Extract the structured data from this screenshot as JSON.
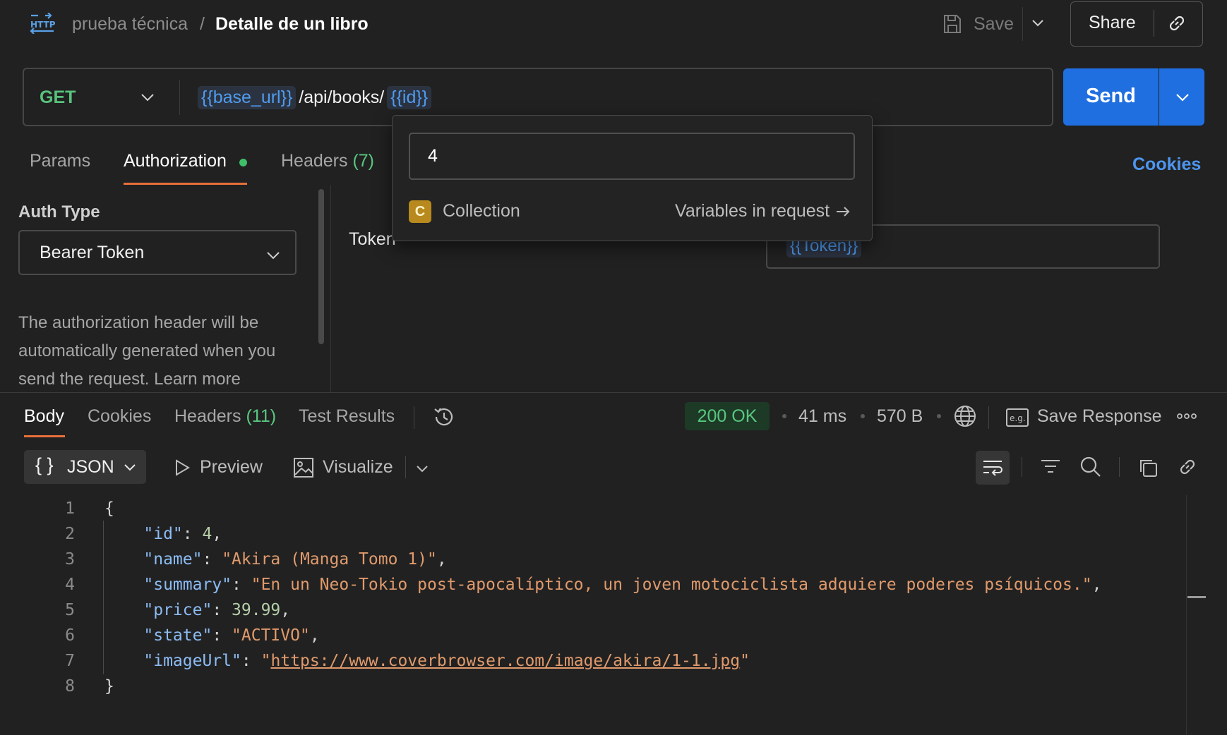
{
  "header": {
    "collection": "prueba técnica",
    "separator": "/",
    "title": "Detalle de un libro",
    "save_label": "Save",
    "share_label": "Share"
  },
  "request": {
    "method": "GET",
    "url_parts": {
      "base": "{{base_url}}",
      "path": "/api/books/",
      "id_var": "{{id}}"
    },
    "send_label": "Send"
  },
  "req_tabs": {
    "params": "Params",
    "authorization": "Authorization",
    "headers": "Headers",
    "headers_count": "(7)",
    "cookies": "Cookies"
  },
  "auth": {
    "type_label": "Auth Type",
    "type_value": "Bearer Token",
    "description": "The authorization header will be automatically generated when you send the request. Learn more",
    "token_label": "Token",
    "token_value": "{{Token}}"
  },
  "popover": {
    "value": "4",
    "scope_badge": "C",
    "scope_name": "Collection",
    "link_label": "Variables in request"
  },
  "response": {
    "tabs": {
      "body": "Body",
      "cookies": "Cookies",
      "headers": "Headers",
      "headers_count": "(11)",
      "tests": "Test Results"
    },
    "status": "200 OK",
    "time": "41 ms",
    "size": "570 B",
    "save_response": "Save Response",
    "format": "JSON",
    "preview": "Preview",
    "visualize": "Visualize"
  },
  "code": {
    "line_numbers": [
      "1",
      "2",
      "3",
      "4",
      "5",
      "6",
      "7",
      "8"
    ],
    "open_brace": "{",
    "close_brace": "}",
    "fields": [
      {
        "key": "\"id\"",
        "value": "4",
        "kind": "number"
      },
      {
        "key": "\"name\"",
        "value": "\"Akira (Manga Tomo 1)\"",
        "kind": "string"
      },
      {
        "key": "\"summary\"",
        "value": "\"En un Neo-Tokio post-apocalíptico, un joven motociclista adquiere poderes psíquicos.\"",
        "kind": "string"
      },
      {
        "key": "\"price\"",
        "value": "39.99",
        "kind": "number"
      },
      {
        "key": "\"state\"",
        "value": "\"ACTIVO\"",
        "kind": "string"
      },
      {
        "key": "\"imageUrl\"",
        "value": "https://www.coverbrowser.com/image/akira/1-1.jpg",
        "kind": "url"
      }
    ]
  },
  "colors": {
    "background": "#212121",
    "accent_orange": "#e8703a",
    "send_blue": "#1f6fe0",
    "method_green": "#58c27d",
    "variable_blue": "#4f9cf0",
    "status_green_bg": "#1d3a27"
  },
  "icons": [
    "http-icon",
    "save-icon",
    "chevron-down-icon",
    "link-icon",
    "history-icon",
    "globe-icon",
    "example-icon",
    "more-icon",
    "play-icon",
    "image-icon",
    "wrap-icon",
    "filter-icon",
    "search-icon",
    "copy-icon",
    "arrow-right-icon"
  ]
}
